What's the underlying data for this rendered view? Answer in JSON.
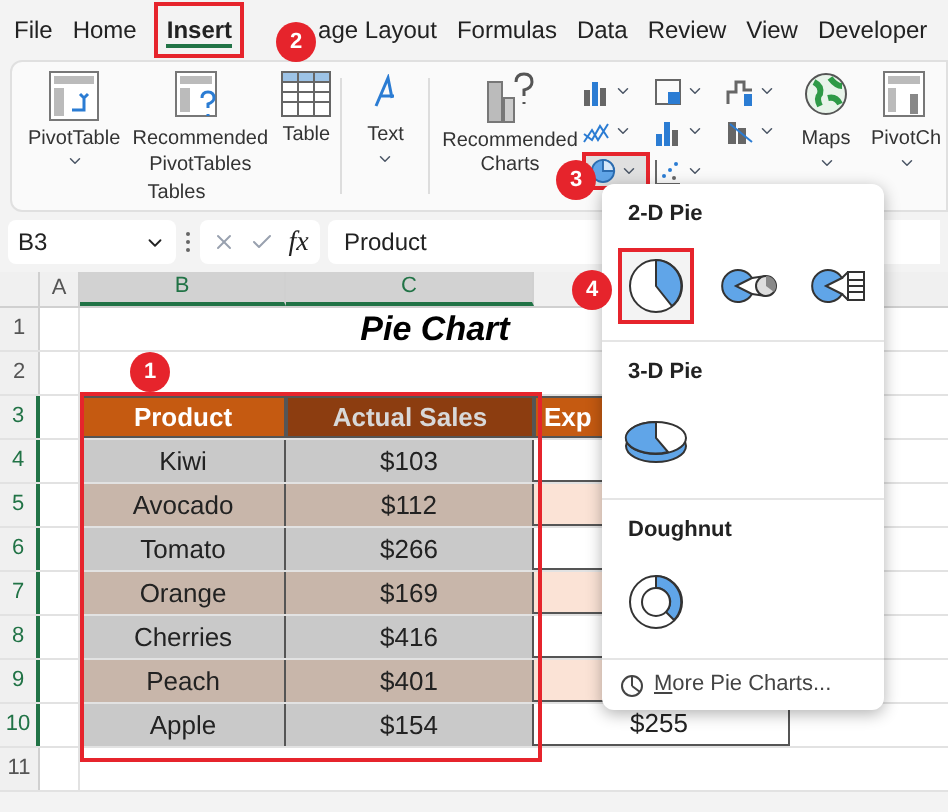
{
  "tabs": [
    {
      "label": "File",
      "selected": false
    },
    {
      "label": "Home",
      "selected": false
    },
    {
      "label": "Insert",
      "selected": true
    },
    {
      "label": "age Layout",
      "selected": false
    },
    {
      "label": "Formulas",
      "selected": false
    },
    {
      "label": "Data",
      "selected": false
    },
    {
      "label": "Review",
      "selected": false
    },
    {
      "label": "View",
      "selected": false
    },
    {
      "label": "Developer",
      "selected": false
    }
  ],
  "ribbon": {
    "tables_buttons": [
      {
        "kind": "pivot",
        "label": "PivotTable"
      },
      {
        "kind": "recpivot",
        "label": "Recommended PivotTables"
      },
      {
        "kind": "table",
        "label": "Table"
      }
    ],
    "tables_label": "Tables",
    "text_button": "Text",
    "recommended_charts": "Recommended Charts",
    "maps": "Maps",
    "pivot_chart": "PivotCh"
  },
  "callouts": [
    "1",
    "2",
    "3",
    "4"
  ],
  "formula_bar": {
    "name_box": "B3",
    "fx": "fx",
    "formula": "Product"
  },
  "columns": [
    {
      "label": "A",
      "selected": false
    },
    {
      "label": "B",
      "selected": true
    },
    {
      "label": "C",
      "selected": true
    }
  ],
  "rows": [
    {
      "label": "1",
      "selected": false
    },
    {
      "label": "2",
      "selected": false
    },
    {
      "label": "3",
      "selected": true
    },
    {
      "label": "4",
      "selected": true
    },
    {
      "label": "5",
      "selected": true
    },
    {
      "label": "6",
      "selected": true
    },
    {
      "label": "7",
      "selected": true
    },
    {
      "label": "8",
      "selected": true
    },
    {
      "label": "9",
      "selected": true
    },
    {
      "label": "10",
      "selected": true
    },
    {
      "label": "11",
      "selected": false
    }
  ],
  "title": "Pie Chart",
  "table": {
    "headers": [
      "Product",
      "Actual Sales",
      "Exp"
    ],
    "rows": [
      {
        "product": "Kiwi",
        "sales": "$103"
      },
      {
        "product": "Avocado",
        "sales": "$112"
      },
      {
        "product": "Tomato",
        "sales": "$266"
      },
      {
        "product": "Orange",
        "sales": "$169"
      },
      {
        "product": "Cherries",
        "sales": "$416"
      },
      {
        "product": "Peach",
        "sales": "$401"
      },
      {
        "product": "Apple",
        "sales": "$154",
        "expected": "$255"
      }
    ]
  },
  "dropdown": {
    "sections": [
      {
        "title": "2-D Pie",
        "charts": [
          {
            "kind": "pie",
            "selected": true
          },
          {
            "kind": "pie-of-pie",
            "selected": false
          },
          {
            "kind": "bar-of-pie",
            "selected": false
          }
        ]
      },
      {
        "title": "3-D Pie",
        "charts": [
          {
            "kind": "pie-3d",
            "selected": false
          }
        ]
      },
      {
        "title": "Doughnut",
        "charts": [
          {
            "kind": "doughnut",
            "selected": false
          }
        ]
      }
    ],
    "more": "More Pie Charts..."
  }
}
